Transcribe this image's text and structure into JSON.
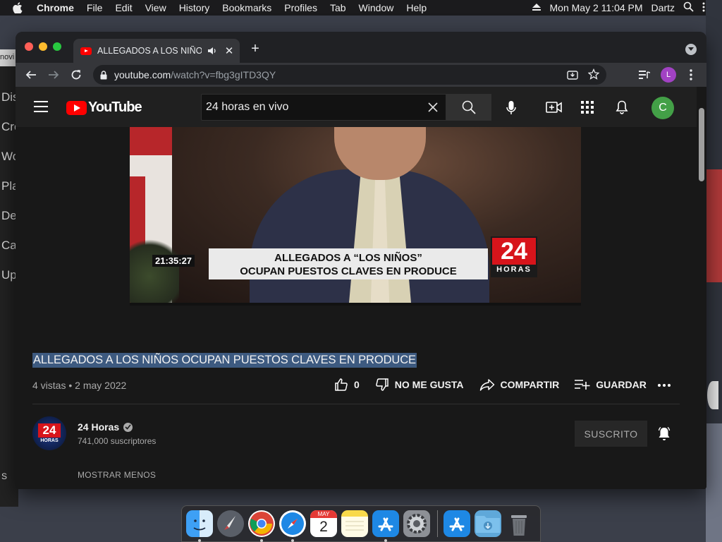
{
  "menubar": {
    "app": "Chrome",
    "items": [
      "File",
      "Edit",
      "View",
      "History",
      "Bookmarks",
      "Profiles",
      "Tab",
      "Window",
      "Help"
    ],
    "clock": "Mon May 2  11:04 PM",
    "user": "Dartz"
  },
  "background_window": {
    "tab_label": "novi",
    "items": [
      "Dis",
      "Cre",
      "Wo",
      "Pla",
      "De",
      "Ca",
      "Up"
    ],
    "footer": "S"
  },
  "browser": {
    "tab_title": "ALLEGADOS A LOS NIÑOS",
    "url_host": "youtube.com",
    "url_path": "/watch?v=fbg3gITD3QY",
    "profile_initial": "L"
  },
  "youtube": {
    "logo_text": "YouTube",
    "search_value": "24 horas en vivo",
    "avatar_initial": "C",
    "video": {
      "timestamp": "21:35:27",
      "banner_line1": "ALLEGADOS A “LOS NIÑOS”",
      "banner_line2": "OCUPAN PUESTOS CLAVES EN PRODUCE",
      "logo_number": "24",
      "logo_word": "HORAS"
    },
    "title": "ALLEGADOS A LOS NIÑOS OCUPAN PUESTOS CLAVES EN PRODUCE",
    "views_date": "4 vistas • 2 may 2022",
    "like_count": "0",
    "dislike_label": "NO ME GUSTA",
    "share_label": "COMPARTIR",
    "save_label": "GUARDAR",
    "channel": {
      "name": "24 Horas",
      "subscribers": "741,000 suscriptores",
      "avatar_number": "24",
      "avatar_word": "HORAS",
      "subscribed_label": "SUSCRITO"
    },
    "show_less": "MOSTRAR MENOS"
  },
  "dock": {
    "apps": [
      "finder-icon",
      "launchpad-icon",
      "chrome-icon",
      "safari-icon",
      "calendar-icon",
      "notes-icon",
      "app-store-icon",
      "system-preferences-icon",
      "app-store-icon",
      "downloads-folder-icon",
      "trash-icon"
    ],
    "calendar_month": "MAY",
    "calendar_day": "2"
  },
  "colors": {
    "yt_red": "#ff0000",
    "background": "#181818",
    "selection": "#3d5a80"
  }
}
